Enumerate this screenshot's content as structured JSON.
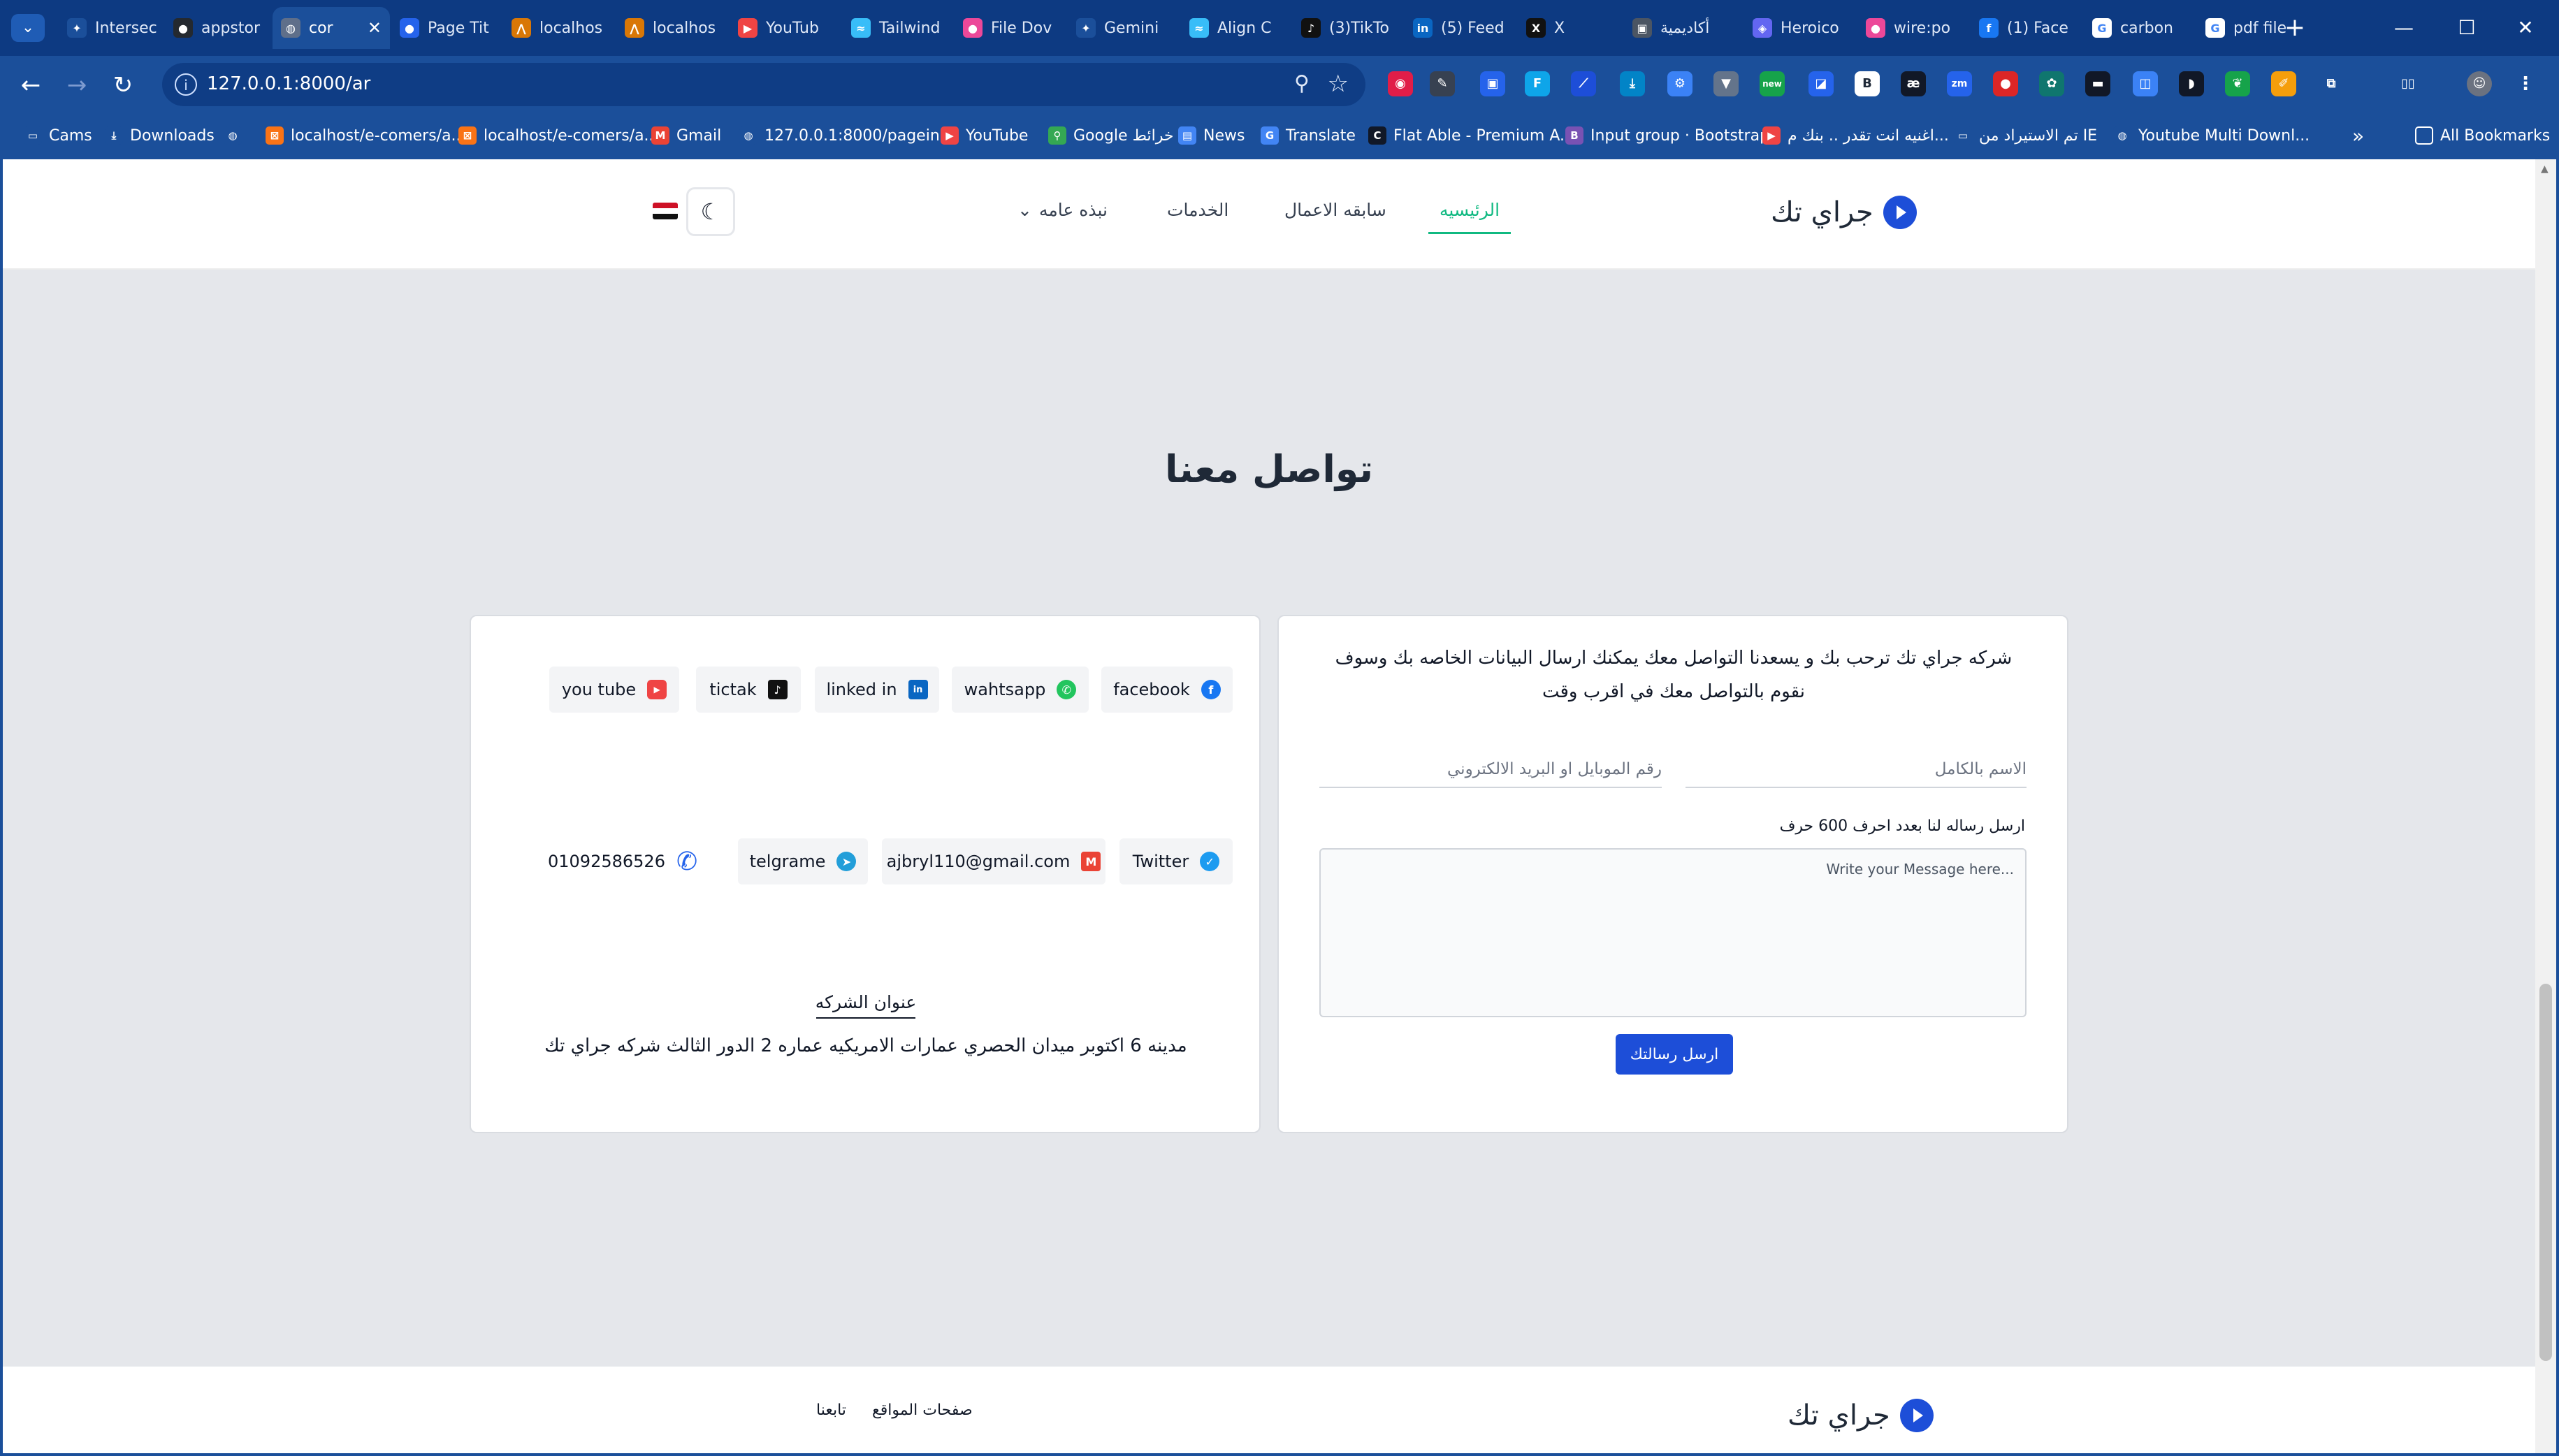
{
  "browser": {
    "tabs": [
      {
        "title": "Intersec",
        "fav": "diamond-icon",
        "color": "#1b4f9a",
        "glyph": "✦"
      },
      {
        "title": "appstor",
        "fav": "github-icon",
        "color": "#24292f",
        "glyph": "●"
      },
      {
        "title": "cor",
        "fav": "globe-icon",
        "color": "#5f6f8a",
        "glyph": "◍",
        "active": true
      },
      {
        "title": "Page Tit",
        "fav": "circle-icon",
        "color": "#2563eb",
        "glyph": "●"
      },
      {
        "title": "localhos",
        "fav": "xampp-icon",
        "color": "#d97706",
        "glyph": "⋀"
      },
      {
        "title": "localhos",
        "fav": "xampp-icon",
        "color": "#d97706",
        "glyph": "⋀"
      },
      {
        "title": "YouTub",
        "fav": "youtube-icon",
        "color": "#ef4444",
        "glyph": "▶"
      },
      {
        "title": "Tailwind",
        "fav": "tailwind-icon",
        "color": "#38bdf8",
        "glyph": "≈"
      },
      {
        "title": "File Dov",
        "fav": "file-icon",
        "color": "#ec4899",
        "glyph": "●"
      },
      {
        "title": "Gemini",
        "fav": "gemini-icon",
        "color": "#1b4f9a",
        "glyph": "✦"
      },
      {
        "title": "Align C",
        "fav": "tailwind-icon",
        "color": "#38bdf8",
        "glyph": "≈"
      },
      {
        "title": "(3)TikTo",
        "fav": "tiktok-icon",
        "color": "#111111",
        "glyph": "♪"
      },
      {
        "title": "(5) Feed",
        "fav": "linkedin-icon",
        "color": "#0a66c2",
        "glyph": "in"
      },
      {
        "title": "X",
        "fav": "x-icon",
        "color": "#111111",
        "glyph": "X"
      },
      {
        "title": "أكاديمية",
        "fav": "academy-icon",
        "color": "#4b5563",
        "glyph": "▣"
      },
      {
        "title": "Heroico",
        "fav": "shield-icon",
        "color": "#6366f1",
        "glyph": "◈"
      },
      {
        "title": "wire:po",
        "fav": "livewire-icon",
        "color": "#ec4899",
        "glyph": "●"
      },
      {
        "title": "(1) Face",
        "fav": "facebook-icon",
        "color": "#1877f2",
        "glyph": "f"
      },
      {
        "title": "carbon",
        "fav": "google-icon",
        "color": "#ffffff",
        "glyph": "G"
      },
      {
        "title": "pdf file",
        "fav": "google-icon",
        "color": "#ffffff",
        "glyph": "G"
      }
    ],
    "url": "127.0.0.1:8000/ar",
    "bookmarks": [
      {
        "label": "Cams",
        "icon": "folder-icon",
        "color": "#1b4f9a",
        "glyph": "▭"
      },
      {
        "label": "Downloads",
        "icon": "download-icon",
        "color": "#1b4f9a",
        "glyph": "⤓"
      },
      {
        "label": "",
        "icon": "globe-icon",
        "color": "#1b4f9a",
        "glyph": "◍"
      },
      {
        "label": "localhost/e-comers/a...",
        "icon": "xampp-icon",
        "color": "#f97316",
        "glyph": "⊠"
      },
      {
        "label": "localhost/e-comers/a...",
        "icon": "xampp-icon",
        "color": "#f97316",
        "glyph": "⊠"
      },
      {
        "label": "Gmail",
        "icon": "gmail-icon",
        "color": "#ea4335",
        "glyph": "M"
      },
      {
        "label": "127.0.0.1:8000/pagein...",
        "icon": "globe-icon",
        "color": "#1b4f9a",
        "glyph": "◍"
      },
      {
        "label": "YouTube",
        "icon": "youtube-icon",
        "color": "#ef4444",
        "glyph": "▶"
      },
      {
        "label": "Google خرائط",
        "icon": "maps-icon",
        "color": "#34a853",
        "glyph": "⚲"
      },
      {
        "label": "News",
        "icon": "news-icon",
        "color": "#4285f4",
        "glyph": "▤"
      },
      {
        "label": "Translate",
        "icon": "translate-icon",
        "color": "#4285f4",
        "glyph": "G"
      },
      {
        "label": "Flat Able - Premium A...",
        "icon": "flatable-icon",
        "color": "#111827",
        "glyph": "C"
      },
      {
        "label": "Input group · Bootstrap",
        "icon": "bootstrap-icon",
        "color": "#7952b3",
        "glyph": "B"
      },
      {
        "label": "اغنيه انت تقدر .. بنك م...",
        "icon": "youtube-icon",
        "color": "#ef4444",
        "glyph": "▶"
      },
      {
        "label": "تم الاستيراد من IE",
        "icon": "folder-icon",
        "color": "#1b4f9a",
        "glyph": "▭"
      },
      {
        "label": "Youtube Multi Downl...",
        "icon": "globe-icon",
        "color": "#1b4f9a",
        "glyph": "◍"
      }
    ],
    "all_bookmarks": "All Bookmarks",
    "more_bookmarks": "»"
  },
  "header": {
    "brand": "جراي تك",
    "nav": {
      "home": "الرئيسيه",
      "portfolio": "سابقه الاعمال",
      "services": "الخدمات",
      "about": "نبذه عامه"
    }
  },
  "contact": {
    "title": "تواصل معنا",
    "socials_row1": [
      {
        "label": "facebook",
        "icon": "facebook-icon",
        "color": "#1877f2",
        "glyph": "f"
      },
      {
        "label": "wahtsapp",
        "icon": "whatsapp-icon",
        "color": "#22c55e",
        "glyph": "✆"
      },
      {
        "label": "linked in",
        "icon": "linkedin-icon",
        "color": "#0a66c2",
        "glyph": "in"
      },
      {
        "label": "tictak",
        "icon": "tiktok-icon",
        "color": "#111111",
        "glyph": "♪"
      },
      {
        "label": "you tube",
        "icon": "youtube-icon",
        "color": "#ef4444",
        "glyph": "▶"
      }
    ],
    "socials_row2": [
      {
        "label": "Twitter",
        "icon": "twitter-icon",
        "color": "#1d9bf0",
        "glyph": "✓"
      },
      {
        "label": "ajbryl110@gmail.com",
        "icon": "gmail-icon",
        "color": "#ea4335",
        "glyph": "M"
      },
      {
        "label": "telgrame",
        "icon": "telegram-icon",
        "color": "#229ed9",
        "glyph": "➤"
      }
    ],
    "phone": "01092586526",
    "address_title": "عنوان الشركه",
    "address": "مدينه 6 اكتوبر ميدان الحصري عمارات الامريكيه عماره 2 الدور الثالث شركه جراي تك"
  },
  "form": {
    "intro": "شركه جراي تك ترحب بك و يسعدنا التواصل معك يمكنك ارسال البيانات الخاصه بك وسوف نقوم بالتواصل معك في اقرب وقت",
    "name_placeholder": "الاسم بالكامل",
    "contact_placeholder": "رقم الموبايل او البريد الالكتروني",
    "message_label": "ارسل رساله لنا بعدد احرف 600 حرف",
    "message_placeholder": "Write your Message here...",
    "submit": "ارسل رسالتك"
  },
  "footer": {
    "brand": "جراي تك",
    "sites": "صفحات المواقع",
    "follow": "تابعنا"
  },
  "colors": {
    "accent": "#1d4ed8",
    "active_nav": "#10b981",
    "chrome": "#1b4f9a"
  }
}
